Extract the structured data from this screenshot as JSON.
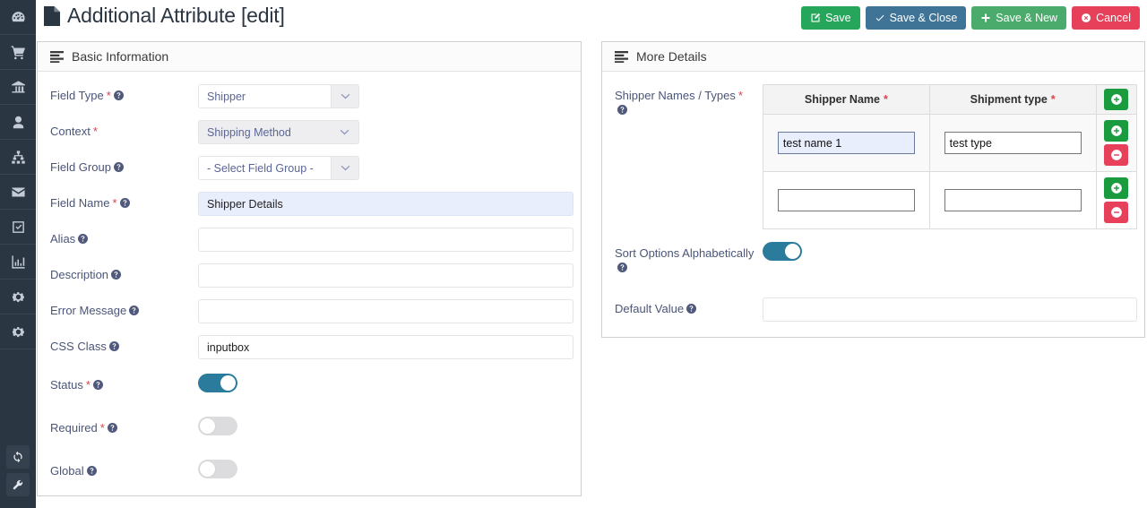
{
  "sidebar": {
    "items": [
      {
        "icon": "dashboard-gauge-icon",
        "name": "sidebar-item-dashboard"
      },
      {
        "icon": "shopping-cart-icon",
        "name": "sidebar-item-sales"
      },
      {
        "icon": "bank-icon",
        "name": "sidebar-item-accounts"
      },
      {
        "icon": "user-icon",
        "name": "sidebar-item-users"
      },
      {
        "icon": "sitemap-icon",
        "name": "sidebar-item-structure"
      },
      {
        "icon": "envelope-icon",
        "name": "sidebar-item-messages"
      },
      {
        "icon": "check-square-icon",
        "name": "sidebar-item-tasks"
      },
      {
        "icon": "bar-chart-icon",
        "name": "sidebar-item-reports"
      },
      {
        "icon": "gear-icon",
        "name": "sidebar-item-settings"
      },
      {
        "icon": "gear-icon",
        "name": "sidebar-item-configuration"
      }
    ],
    "bottom": [
      {
        "icon": "refresh-icon",
        "name": "sidebar-refresh-button"
      },
      {
        "icon": "wrench-icon",
        "name": "sidebar-tools-button"
      }
    ]
  },
  "header": {
    "title": "Additional Attribute [edit]",
    "title_icon": "file-icon",
    "buttons": [
      {
        "label": "Save",
        "icon": "pencil-square-icon",
        "style": "btn-save",
        "name": "save-button"
      },
      {
        "label": "Save & Close",
        "icon": "check-icon",
        "style": "btn-close",
        "name": "save-and-close-button"
      },
      {
        "label": "Save & New",
        "icon": "plus-icon",
        "style": "btn-new",
        "name": "save-and-new-button"
      },
      {
        "label": "Cancel",
        "icon": "times-circle-icon",
        "style": "btn-cancel",
        "name": "cancel-button"
      }
    ]
  },
  "left_panel": {
    "title": "Basic Information",
    "icon": "list-bars-icon",
    "fields": {
      "field_type": {
        "label": "Field Type",
        "required": true,
        "has_help": true,
        "value": "Shipper",
        "type": "select",
        "disabled": false
      },
      "context": {
        "label": "Context",
        "required": true,
        "has_help": false,
        "value": "Shipping Method",
        "type": "select",
        "disabled": true
      },
      "field_group": {
        "label": "Field Group",
        "required": false,
        "has_help": true,
        "value": "- Select Field Group -",
        "type": "select",
        "disabled": false
      },
      "field_name": {
        "label": "Field Name",
        "required": true,
        "has_help": true,
        "value": "Shipper Details",
        "placeholder": "",
        "type": "text",
        "autofilled": true
      },
      "alias": {
        "label": "Alias",
        "required": false,
        "has_help": true,
        "value": "",
        "placeholder": "",
        "type": "text",
        "autofilled": false
      },
      "description": {
        "label": "Description",
        "required": false,
        "has_help": true,
        "value": "",
        "placeholder": "",
        "type": "text",
        "autofilled": false
      },
      "error_message": {
        "label": "Error Message",
        "required": false,
        "has_help": true,
        "value": "",
        "placeholder": "",
        "type": "text",
        "autofilled": false
      },
      "css_class": {
        "label": "CSS Class",
        "required": false,
        "has_help": true,
        "value": "inputbox",
        "placeholder": "",
        "type": "text",
        "autofilled": false
      },
      "status": {
        "label": "Status",
        "required": true,
        "has_help": true,
        "value": "on",
        "type": "toggle"
      },
      "required_field": {
        "label": "Required",
        "required": true,
        "has_help": true,
        "value": "off",
        "type": "toggle"
      },
      "global": {
        "label": "Global",
        "required": false,
        "has_help": true,
        "value": "off",
        "type": "toggle"
      }
    }
  },
  "right_panel": {
    "title": "More Details",
    "icon": "list-bars-icon",
    "shipper_names": {
      "label": "Shipper Names / Types",
      "required": true,
      "has_help": true,
      "columns": [
        {
          "header": "Shipper Name",
          "required": true
        },
        {
          "header": "Shipment type",
          "required": true
        }
      ],
      "header_action": {
        "icon": "plus-circle-icon",
        "name": "add-row-header-button"
      },
      "rows": [
        {
          "shipper_name": "test name 1",
          "shipment_type": "test type",
          "name_focused": true,
          "type_focused": false,
          "actions": [
            {
              "icon": "plus-circle-icon",
              "style": "mini-add",
              "name": "add-row-button"
            },
            {
              "icon": "minus-circle-icon",
              "style": "mini-del",
              "name": "remove-row-button"
            }
          ]
        },
        {
          "shipper_name": "",
          "shipment_type": "",
          "name_focused": false,
          "type_focused": false,
          "actions": [
            {
              "icon": "plus-circle-icon",
              "style": "mini-add",
              "name": "add-row-button"
            },
            {
              "icon": "minus-circle-icon",
              "style": "mini-del",
              "name": "remove-row-button"
            }
          ]
        }
      ]
    },
    "sort_options": {
      "label": "Sort Options Alphabetically",
      "has_help": true,
      "value": "on"
    },
    "default_value": {
      "label": "Default Value",
      "has_help": true,
      "value": "",
      "placeholder": ""
    }
  },
  "colors": {
    "sidebar_bg": "#2b3643",
    "accent_blue": "#2b7b9c",
    "label_text": "#4a5578",
    "required_red": "#d9434f",
    "save_green": "#26a65b",
    "close_blue": "#3f7496",
    "new_green": "#4aab6c",
    "cancel_red": "#e7405a",
    "add_green": "#1a9c3e",
    "autofill_blue": "#e8eefc"
  }
}
